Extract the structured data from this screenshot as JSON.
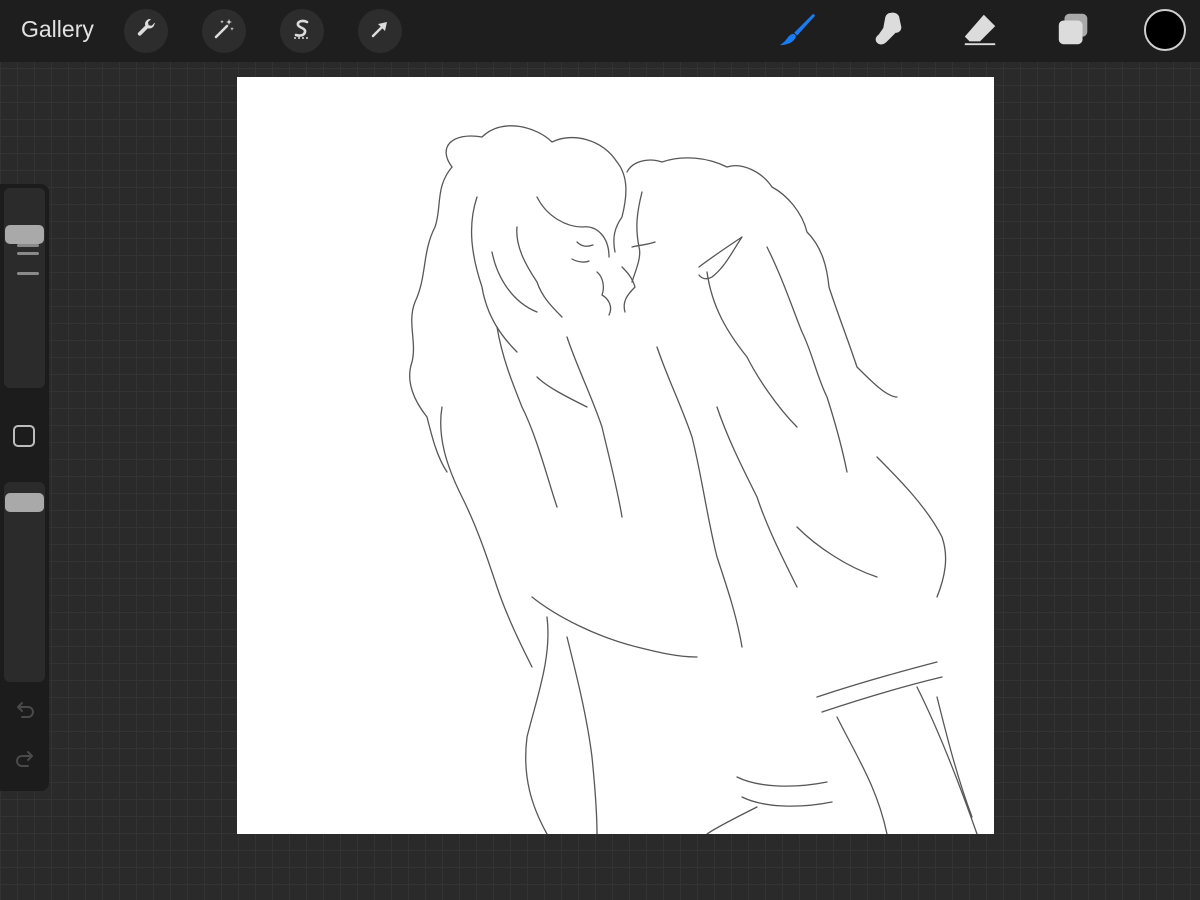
{
  "app": {
    "gallery_label": "Gallery",
    "accent_color": "#1a7cf5",
    "current_color": "#000000",
    "canvas_background": "#ffffff"
  },
  "toolbar_left": [
    {
      "name": "actions",
      "icon": "wrench-icon"
    },
    {
      "name": "adjustments",
      "icon": "magic-wand-icon"
    },
    {
      "name": "selection",
      "icon": "selection-s-icon"
    },
    {
      "name": "transform",
      "icon": "arrow-cursor-icon"
    }
  ],
  "toolbar_right": [
    {
      "name": "brush",
      "icon": "brush-icon",
      "active": true
    },
    {
      "name": "smudge",
      "icon": "smudge-finger-icon",
      "active": false
    },
    {
      "name": "eraser",
      "icon": "eraser-icon",
      "active": false
    },
    {
      "name": "layers",
      "icon": "layers-icon",
      "active": false
    }
  ],
  "sidebar": {
    "brush_size_level": 0.8,
    "opacity_level": 0.95,
    "undo_icon": "undo-icon",
    "redo_icon": "redo-icon"
  }
}
